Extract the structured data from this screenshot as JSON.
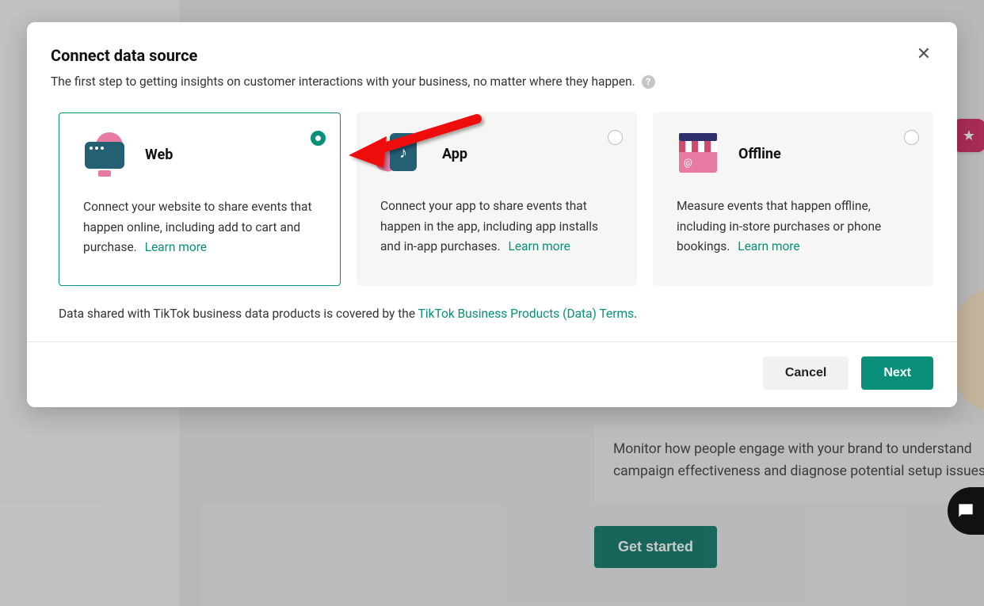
{
  "modal": {
    "title": "Connect data source",
    "subtitle": "The first step to getting insights on customer interactions with your business, no matter where they happen.",
    "help_tooltip": "?",
    "cards": [
      {
        "key": "web",
        "title": "Web",
        "description": "Connect your website to share events that happen online, including add to cart and purchase.",
        "learn_more": "Learn more",
        "selected": true
      },
      {
        "key": "app",
        "title": "App",
        "description": "Connect your app to share events that happen in the app, including app installs and in-app purchases.",
        "learn_more": "Learn more",
        "selected": false
      },
      {
        "key": "offline",
        "title": "Offline",
        "description": "Measure events that happen offline, including in-store purchases or phone bookings.",
        "learn_more": "Learn more",
        "selected": false
      }
    ],
    "terms_prefix": "Data shared with TikTok business data products is covered by the ",
    "terms_link": "TikTok Business Products (Data) Terms",
    "terms_suffix": ".",
    "buttons": {
      "cancel": "Cancel",
      "next": "Next"
    }
  },
  "background": {
    "panel_text": "Monitor how people engage with your brand to understand campaign effectiveness and diagnose potential setup issues.",
    "get_started": "Get started"
  }
}
